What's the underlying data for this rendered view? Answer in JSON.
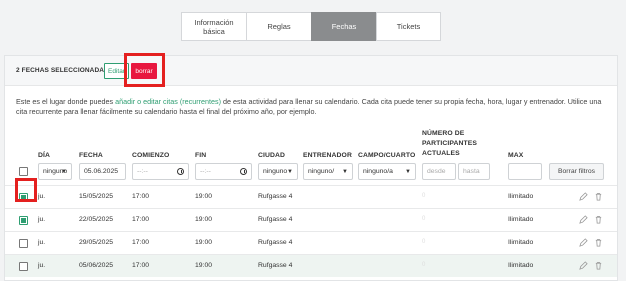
{
  "tabs": [
    {
      "label": "Información\nbásica",
      "active": false
    },
    {
      "label": "Reglas",
      "active": false
    },
    {
      "label": "Fechas",
      "active": true
    },
    {
      "label": "Tickets",
      "active": false
    }
  ],
  "selection": {
    "count_text": "2 FECHAS SELECCIONADAS",
    "edit_label": "Editar",
    "delete_label": "borrar"
  },
  "description": {
    "before": "Este es el lugar donde puedes ",
    "link": "añadir o editar citas (recurrentes)",
    "after": " de esta actividad para llenar su calendario. Cada cita puede tener su propia fecha, hora, lugar y entrenador. Utilice una cita recurrente para llenar fácilmente su calendario hasta el final del próximo año, por ejemplo."
  },
  "columns": {
    "day": "DÍA",
    "date": "FECHA",
    "start": "COMIENZO",
    "end": "FIN",
    "city": "CIUDAD",
    "trainer": "ENTRENADOR",
    "room": "CAMPO/CUARTO",
    "participants": "NÚMERO DE PARTICIPANTES ACTUALES",
    "max": "MAX"
  },
  "filters": {
    "day": "ninguno",
    "date": "05.06.2025",
    "start": "--:--",
    "end": "--:--",
    "city": "ninguno",
    "trainer": "ninguno/",
    "room": "ninguno/a",
    "from_placeholder": "desde",
    "to_placeholder": "hasta",
    "max": "",
    "clear_label": "Borrar filtros"
  },
  "rows": [
    {
      "checked": true,
      "day": "ju.",
      "date": "15/05/2025",
      "start": "17:00",
      "end": "19:00",
      "city": "Rufgasse 4",
      "participants": "0",
      "max": "Ilimitado"
    },
    {
      "checked": true,
      "day": "ju.",
      "date": "22/05/2025",
      "start": "17:00",
      "end": "19:00",
      "city": "Rufgasse 4",
      "participants": "0",
      "max": "Ilimitado"
    },
    {
      "checked": false,
      "day": "ju.",
      "date": "29/05/2025",
      "start": "17:00",
      "end": "19:00",
      "city": "Rufgasse 4",
      "participants": "0",
      "max": "Ilimitado"
    },
    {
      "checked": false,
      "day": "ju.",
      "date": "05/06/2025",
      "start": "17:00",
      "end": "19:00",
      "city": "Rufgasse 4",
      "participants": "0",
      "max": "Ilimitado"
    }
  ],
  "colors": {
    "accent": "#2f9e72",
    "danger": "#e8173f",
    "highlight": "#e4201f",
    "active_tab": "#8a8c8e"
  },
  "icons": [
    "pencil-icon",
    "trash-icon",
    "clock-icon",
    "chevron-down-icon",
    "checkbox-icon"
  ]
}
